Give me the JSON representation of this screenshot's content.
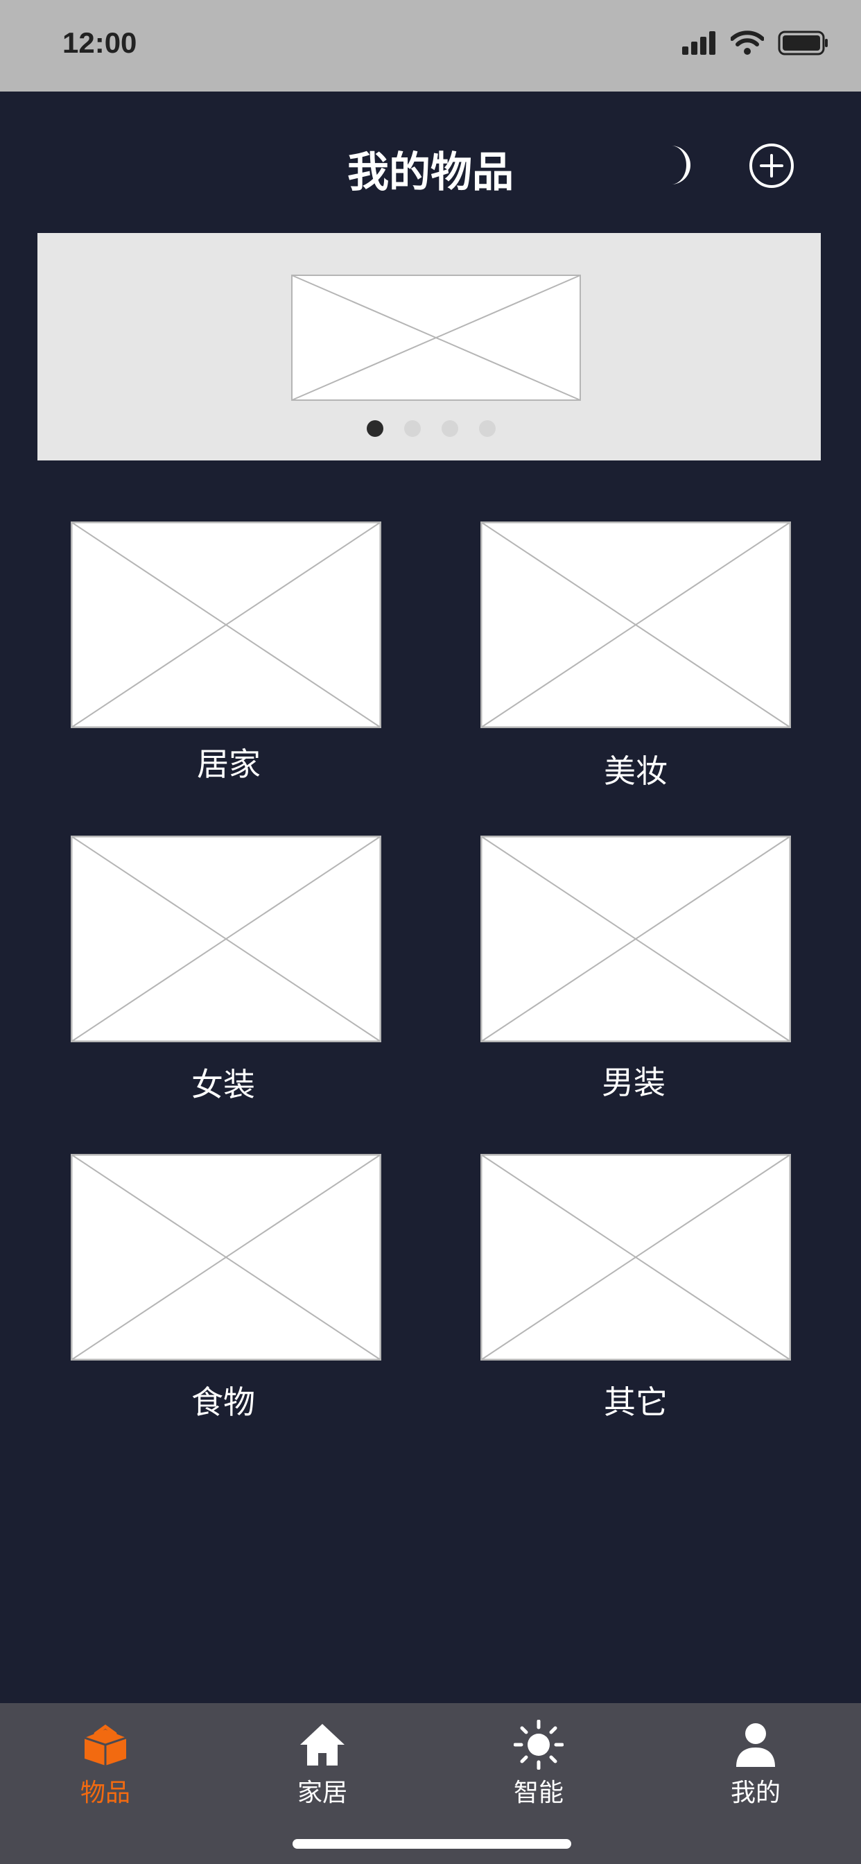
{
  "status_bar": {
    "time": "12:00"
  },
  "header": {
    "title": "我的物品"
  },
  "banner": {
    "dot_count": 4,
    "active_index": 0
  },
  "categories": [
    {
      "label": "居家"
    },
    {
      "label": "美妆"
    },
    {
      "label": "女装"
    },
    {
      "label": "男装"
    },
    {
      "label": "食物"
    },
    {
      "label": "其它"
    }
  ],
  "tabbar": {
    "tabs": [
      {
        "label": "物品",
        "icon": "box-icon",
        "active": true
      },
      {
        "label": "家居",
        "icon": "home-icon",
        "active": false
      },
      {
        "label": "智能",
        "icon": "sun-icon",
        "active": false
      },
      {
        "label": "我的",
        "icon": "user-icon",
        "active": false
      }
    ]
  },
  "colors": {
    "background": "#1b1f31",
    "accent": "#f26a10",
    "tabbar": "#4a4a52",
    "status_bar": "#b7b7b7"
  }
}
